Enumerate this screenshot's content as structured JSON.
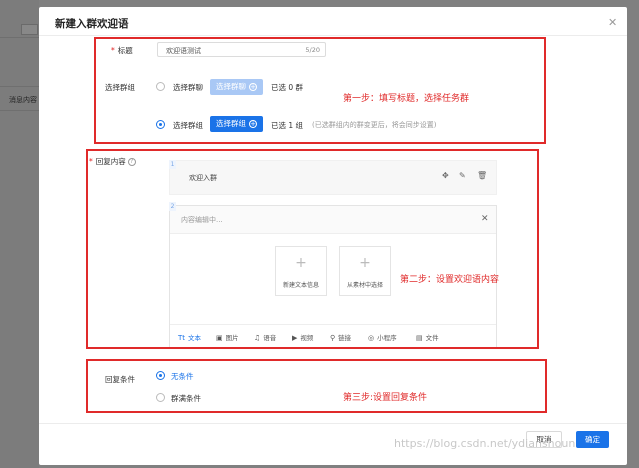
{
  "background": {
    "side_label": "消息内容"
  },
  "modal": {
    "title": "新建入群欢迎语",
    "close_icon": "close-icon"
  },
  "form": {
    "title_label": "标题",
    "title_value": "欢迎语测试",
    "title_count": "5/20",
    "group_label": "选择群组",
    "group_options": [
      {
        "label": "选择群聊",
        "button": "选择群聊",
        "selected_text": "已选 0 群",
        "checked": false
      },
      {
        "label": "选择群组",
        "button": "选择群组",
        "selected_text": "已选 1 组",
        "hint": "(已选群组内的群变更后，将会同步设置)",
        "checked": true
      }
    ],
    "reply_label": "回复内容",
    "reply_help_icon": "question-icon",
    "reply_cards": [
      {
        "num": "1",
        "text": "欢迎入群"
      },
      {
        "num": "2",
        "placeholder": "内容编辑中..."
      }
    ],
    "editor_tiles": [
      {
        "label": "新建文本信息"
      },
      {
        "label": "从素材中选择"
      }
    ],
    "editor_tools": [
      {
        "icon": "Tt",
        "label": "文本",
        "active": true
      },
      {
        "icon": "▣",
        "label": "图片"
      },
      {
        "icon": "♫",
        "label": "语音"
      },
      {
        "icon": "▶",
        "label": "视频"
      },
      {
        "icon": "⚲",
        "label": "链接"
      },
      {
        "icon": "◎",
        "label": "小程序"
      },
      {
        "icon": "▤",
        "label": "文件"
      }
    ],
    "condition_label": "回复条件",
    "condition_options": [
      {
        "label": "无条件",
        "checked": true
      },
      {
        "label": "群满条件",
        "checked": false
      }
    ]
  },
  "annotations": {
    "step1": "第一步：填写标题，选择任务群",
    "step2": "第二步：设置欢迎语内容",
    "step3": "第三步:设置回复条件"
  },
  "footer": {
    "cancel": "取消",
    "ok": "确定"
  },
  "watermark": "https://blog.csdn.net/ydianshoun",
  "colors": {
    "accent": "#1a73e8",
    "annotation": "#e02a2a"
  }
}
